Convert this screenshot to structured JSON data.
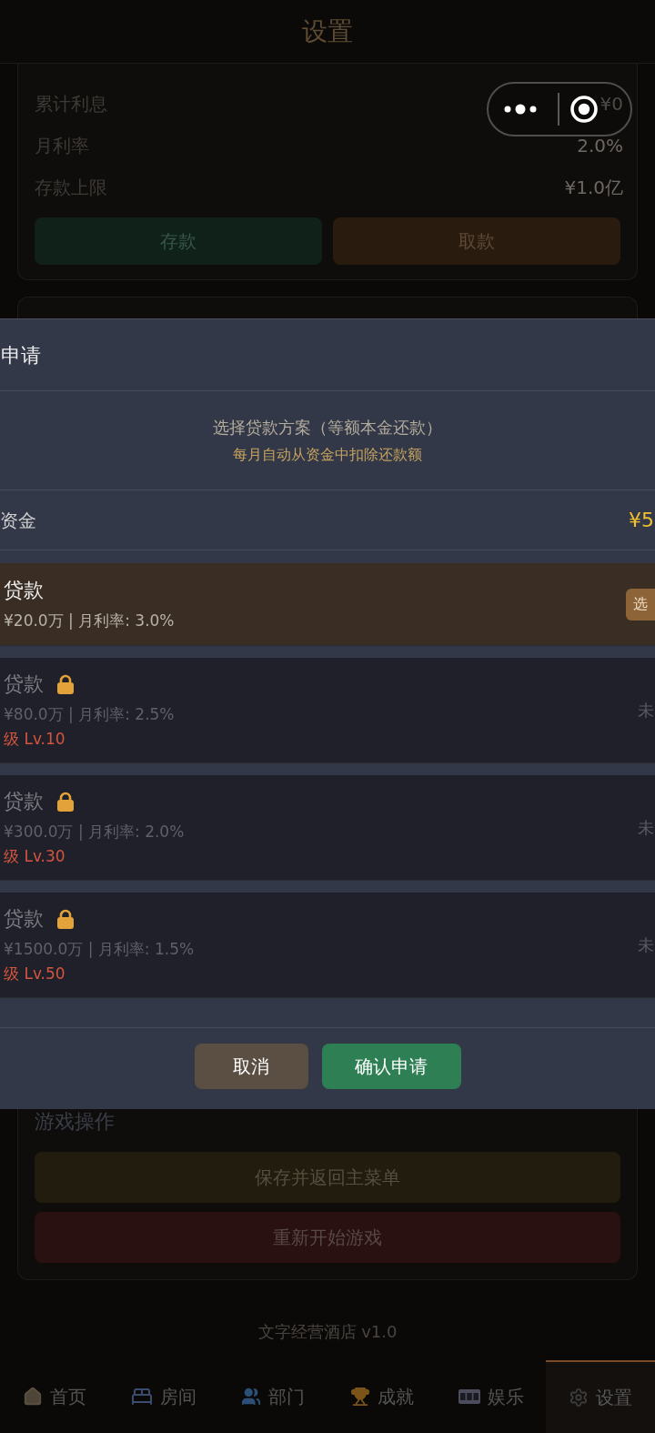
{
  "header": {
    "title": "设置"
  },
  "bank": {
    "rows": [
      {
        "label": "累计利息",
        "value": "¥0"
      },
      {
        "label": "月利率",
        "value": "2.0%"
      },
      {
        "label": "存款上限",
        "value": "¥1.0亿"
      }
    ],
    "buttons": [
      {
        "label": "存款",
        "kind": "deposit"
      },
      {
        "label": "取款",
        "kind": "withdraw"
      }
    ]
  },
  "dialog": {
    "title": "申请",
    "intro": "选择贷款方案（等额本金还款）",
    "note": "每月自动从资金中扣除还款额",
    "funds": {
      "label": "资金",
      "value": "¥5"
    },
    "plans": [
      {
        "name": "贷款",
        "terms": "¥20.0万 | 月利率: 3.0%",
        "selected": true,
        "locked": false,
        "action": "选"
      },
      {
        "name": "贷款",
        "terms": "¥80.0万 | 月利率: 2.5%",
        "selected": false,
        "locked": true,
        "requirement": "级 Lv.10",
        "status": "未"
      },
      {
        "name": "贷款",
        "terms": "¥300.0万 | 月利率: 2.0%",
        "selected": false,
        "locked": true,
        "requirement": "级 Lv.30",
        "status": "未"
      },
      {
        "name": "贷款",
        "terms": "¥1500.0万 | 月利率: 1.5%",
        "selected": false,
        "locked": true,
        "requirement": "级 Lv.50",
        "status": "未"
      }
    ],
    "buttons": [
      {
        "label": "取消",
        "kind": "cancel"
      },
      {
        "label": "确认申请",
        "kind": "confirm"
      }
    ]
  },
  "game_actions": {
    "title": "游戏操作",
    "buttons": [
      {
        "label": "保存并返回主菜单",
        "kind": "save"
      },
      {
        "label": "重新开始游戏",
        "kind": "restart"
      }
    ]
  },
  "footer": "文字经营酒店 v1.0",
  "nav": [
    {
      "label": "首页",
      "selected": false
    },
    {
      "label": "房间",
      "selected": false
    },
    {
      "label": "部门",
      "selected": false
    },
    {
      "label": "成就",
      "selected": false
    },
    {
      "label": "娱乐",
      "selected": false
    },
    {
      "label": "设置",
      "selected": true
    }
  ]
}
